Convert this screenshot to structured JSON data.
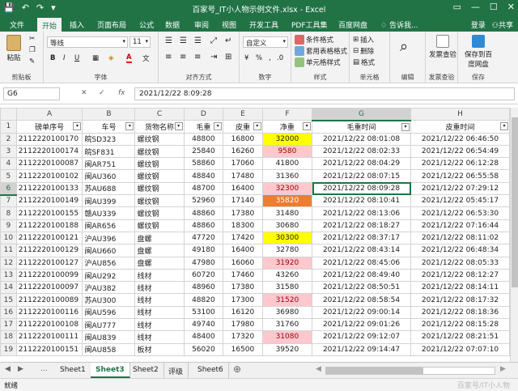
{
  "titlebar": {
    "title": "百家号_IT小人物示例文件.xlsx - Excel",
    "qat": [
      "💾",
      "↶",
      "↷",
      "▾"
    ],
    "winctl": [
      "▭",
      "—",
      "☐",
      "✕"
    ]
  },
  "menu": {
    "tabs": [
      "文件",
      "开始",
      "插入",
      "页面布局",
      "公式",
      "数据",
      "审阅",
      "视图",
      "开发工具",
      "PDF工具集",
      "百度网盘"
    ],
    "active": "开始",
    "search": "告诉我...",
    "login": "登录",
    "share": "共享"
  },
  "ribbon": {
    "paste": "粘贴",
    "clipboard": "剪贴板",
    "font_name": "等线",
    "font_size": "11",
    "font_label": "字体",
    "bold": "B",
    "italic": "I",
    "underline": "U",
    "grow": "A",
    "shrink": "A",
    "align_label": "对齐方式",
    "number_format": "自定义",
    "number_label": "数字",
    "cond_format": "条件格式",
    "table_format": "套用表格格式",
    "cell_style": "单元格样式",
    "style_label": "样式",
    "insert": "插入",
    "delete": "删除",
    "format": "格式",
    "cells_label": "单元格",
    "edit_label": "编辑",
    "invoice_check": "发票查验",
    "invoice_group": "发票查验",
    "save_baidu": "保存到百度网盘",
    "save_group": "保存"
  },
  "formula": {
    "namebox": "G6",
    "value": "2021/12/22  8:09:28"
  },
  "columns": [
    "A",
    "B",
    "C",
    "D",
    "E",
    "F",
    "G",
    "H"
  ],
  "headers": [
    "磅单序号",
    "车号",
    "货物名称",
    "毛重",
    "皮重",
    "净重",
    "毛重时间",
    "皮重时间"
  ],
  "rows": [
    [
      "2112220100170",
      "皖SD323",
      "螺纹钢",
      "48800",
      "16800",
      "32000",
      "2021/12/22 08:01:08",
      "2021/12/22 06:46:50"
    ],
    [
      "2112220100174",
      "皖SF831",
      "螺纹钢",
      "25840",
      "16260",
      "9580",
      "2021/12/22 08:02:33",
      "2021/12/22 06:54:49"
    ],
    [
      "2112220100087",
      "闽AR751",
      "螺纹钢",
      "58860",
      "17060",
      "41800",
      "2021/12/22 08:04:29",
      "2021/12/22 06:12:28"
    ],
    [
      "2112220100102",
      "闽AU360",
      "螺纹钢",
      "48840",
      "17480",
      "31360",
      "2021/12/22 08:07:15",
      "2021/12/22 06:55:58"
    ],
    [
      "2112220100133",
      "苏AU688",
      "螺纹钢",
      "48700",
      "16400",
      "32300",
      "2021/12/22 08:09:28",
      "2021/12/22 07:29:12"
    ],
    [
      "2112220100149",
      "闽AU399",
      "螺纹钢",
      "52960",
      "17140",
      "35820",
      "2021/12/22 08:10:41",
      "2021/12/22 05:45:17"
    ],
    [
      "2112220100155",
      "赣AU339",
      "螺纹钢",
      "48860",
      "17380",
      "31480",
      "2021/12/22 08:13:06",
      "2021/12/22 06:53:30"
    ],
    [
      "2112220100188",
      "闽AR656",
      "螺纹钢",
      "48860",
      "18300",
      "30680",
      "2021/12/22 08:18:27",
      "2021/12/22 07:16:44"
    ],
    [
      "2112220100121",
      "沪AU396",
      "盘螺",
      "47720",
      "17420",
      "30300",
      "2021/12/22 08:37:17",
      "2021/12/22 08:11:02"
    ],
    [
      "2112220100129",
      "闽AU660",
      "盘螺",
      "49180",
      "16400",
      "32780",
      "2021/12/22 08:43:14",
      "2021/12/22 06:48:34"
    ],
    [
      "2112220100127",
      "沪AU856",
      "盘螺",
      "47980",
      "16060",
      "31920",
      "2021/12/22 08:45:06",
      "2021/12/22 08:05:33"
    ],
    [
      "2112220100099",
      "闽AU292",
      "线材",
      "60720",
      "17460",
      "43260",
      "2021/12/22 08:49:40",
      "2021/12/22 08:12:27"
    ],
    [
      "2112220100097",
      "沪AU382",
      "线材",
      "48960",
      "17380",
      "31580",
      "2021/12/22 08:50:51",
      "2021/12/22 08:14:11"
    ],
    [
      "2112220100089",
      "苏AU300",
      "线材",
      "48820",
      "17300",
      "31520",
      "2021/12/22 08:58:54",
      "2021/12/22 08:17:32"
    ],
    [
      "2112220100116",
      "闽AU596",
      "线材",
      "53100",
      "16120",
      "36980",
      "2021/12/22 09:00:14",
      "2021/12/22 08:18:36"
    ],
    [
      "2112220100108",
      "闽AU777",
      "线材",
      "49740",
      "17980",
      "31760",
      "2021/12/22 09:01:26",
      "2021/12/22 08:15:28"
    ],
    [
      "2112220100111",
      "闽AU839",
      "线材",
      "48400",
      "17320",
      "31080",
      "2021/12/22 09:12:07",
      "2021/12/22 08:21:51"
    ],
    [
      "2112220100151",
      "闽AU858",
      "板材",
      "56020",
      "16500",
      "39520",
      "2021/12/22 09:14:47",
      "2021/12/22 07:07:10"
    ]
  ],
  "highlights": {
    "yellow": "#ffff00",
    "pink": "#ffc7ce",
    "orange": "#ed7d31",
    "cells": {
      "2": "yellow",
      "3": "pink",
      "6": "pink",
      "7": "orange",
      "10": "yellow",
      "12": "pink",
      "15": "pink",
      "18": "pink"
    }
  },
  "sheets": {
    "more": "...",
    "tabs": [
      "Sheet1",
      "Sheet3",
      "Sheet2",
      "评级",
      "Sheet6"
    ],
    "active": "Sheet3"
  },
  "status": {
    "ready": "就绪",
    "watermark": "百家号/IT小人物"
  }
}
